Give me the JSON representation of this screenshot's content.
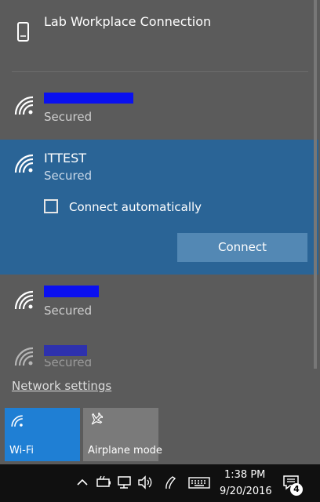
{
  "vpn": {
    "name": "Lab Workplace Connection",
    "icon": "phone-icon"
  },
  "networks": [
    {
      "name_redacted": true,
      "status": "Secured",
      "icon": "wifi-icon"
    },
    {
      "name": "ITTEST",
      "status": "Secured",
      "icon": "wifi-icon",
      "connect_auto_label": "Connect automatically",
      "connect_auto_checked": false,
      "connect_label": "Connect"
    },
    {
      "name_redacted": true,
      "status": "Secured",
      "icon": "wifi-icon"
    },
    {
      "name_redacted": true,
      "status": "Secured",
      "icon": "wifi-icon"
    }
  ],
  "network_settings_label": "Network settings",
  "tiles": [
    {
      "label": "Wi-Fi",
      "active": true,
      "icon": "wifi-icon",
      "color": "#1f7fd4"
    },
    {
      "label": "Airplane mode",
      "active": false,
      "icon": "airplane-icon",
      "color": "#7a7a7a"
    }
  ],
  "taskbar": {
    "time": "1:38 PM",
    "date": "9/20/2016",
    "notification_count": "4",
    "icons": [
      "chevron-up-icon",
      "battery-icon",
      "network-icon",
      "volume-icon",
      "pen-icon",
      "keyboard-icon",
      "action-center-icon"
    ]
  },
  "colors": {
    "panel": "#5b5b5b",
    "selected": "#2a6496",
    "accent": "#1f7fd4",
    "redaction": "#0a10f0"
  }
}
